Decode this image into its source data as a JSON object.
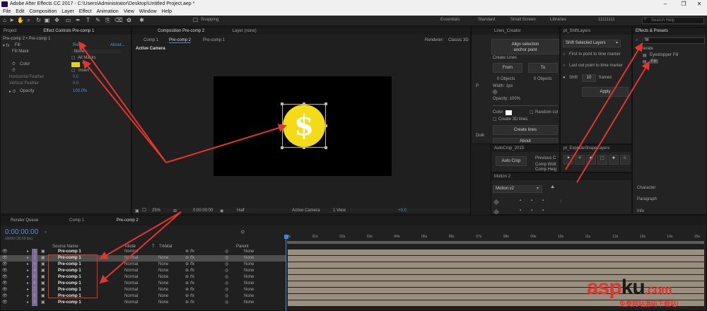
{
  "titlebar": {
    "title": "Adobe After Effects CC 2017 - C:\\Users\\Administrator\\Desktop\\Untitled Project.aep *"
  },
  "menu": [
    "File",
    "Edit",
    "Composition",
    "Layer",
    "Effect",
    "Animation",
    "View",
    "Window",
    "Help"
  ],
  "toolbar": {
    "snapping": "Snapping",
    "workspaces": [
      "Essentials",
      "Standard",
      "Small Screen",
      "Libraries",
      "11111111"
    ],
    "search_placeholder": "Search Help"
  },
  "left_panel": {
    "tab_project": "Project",
    "tab_effect_controls": "Effect Controls Pre-comp 1",
    "breadcrumb": "Pre-comp 2 • Pre-comp 1",
    "effect_name": "Fill",
    "reset": "Reset",
    "about": "About...",
    "fill_mask_label": "Fill Mask",
    "fill_mask_value": "None",
    "all_masks": "All Masks",
    "color_label": "Color",
    "invert": "Invert",
    "horizontal_feather": "Horizontal Feather",
    "horizontal_feather_value": "0.0",
    "vertical_feather": "Vertical Feather",
    "vertical_feather_value": "0.0",
    "opacity_label": "Opacity",
    "opacity_value": "100.0%"
  },
  "comp_panel": {
    "tab_comp": "Composition Pre-comp 2",
    "tab_layer": "Layer (none)",
    "crumb1": "Comp 1",
    "crumb2": "Pre-comp 2",
    "crumb3": "Pre-comp 1",
    "renderer_label": "Renderer:",
    "renderer_value": "Classic 3D",
    "active_camera": "Active Camera",
    "zoom": "25%",
    "timecode": "0:00:00:00",
    "resolution": "Half",
    "view": "Active Camera",
    "views": "1 View",
    "exposure": "+0.0"
  },
  "lines_creator": {
    "title": "Lines_Creator",
    "align": "Align selection",
    "anchor": "anchor point",
    "create_lines": "Create Lines",
    "from": "From",
    "to": "To",
    "objects_from": "0 Objects",
    "objects_to": "0 Objects",
    "width": "Width: 1px",
    "opacity": "Opacity: 100%",
    "color": "Color",
    "random_col": "Random col",
    "create_3d": "Create 3D lines",
    "create_lines_btn": "Create lines",
    "about": "About",
    "duik": "Duik"
  },
  "shift_layers": {
    "title": "pt_ShiftLayers",
    "dropdown": "Shift Selected Layers",
    "first_in": "First in point to time marker",
    "last_out": "Last out point to time marker",
    "shift_label": "Shift",
    "shift_value": "10",
    "frames": "frames",
    "apply": "Apply"
  },
  "autocrop": {
    "title": "AutoCrop_2015",
    "btn": "Auto Crop",
    "previous": "Previous C",
    "comp_width": "Comp Widt",
    "comp_height": "Comp Heig"
  },
  "explode": {
    "title": "pt_ExplodeShapeLayers"
  },
  "motion": {
    "title": "Motion 2",
    "dropdown": "Motion v2"
  },
  "effects_presets": {
    "title": "Effects & Presets",
    "search": "fill",
    "category": "Generate",
    "item1": "Eyedropper Fill",
    "item2": "Fill",
    "character": "Character",
    "paragraph": "Paragraph",
    "info": "Info"
  },
  "timeline": {
    "tab_render": "Render Queue",
    "tab_comp1": "Comp 1",
    "tab_precomp2": "Pre-comp 2",
    "timecode": "0:00:00:00",
    "fps": "00000 (30.00 fps)",
    "col_source": "Source Name",
    "col_mode": "Mode",
    "col_t": "T",
    "col_trkmat": "TrkMat",
    "col_parent": "Parent",
    "layers": [
      {
        "num": "1",
        "name": "Pre-comp 1",
        "mode": "Normal",
        "trkmat": "",
        "parent": "None"
      },
      {
        "num": "2",
        "name": "Pre-comp 1",
        "mode": "Normal",
        "trkmat": "None",
        "parent": "None"
      },
      {
        "num": "3",
        "name": "Pre-comp 1",
        "mode": "Normal",
        "trkmat": "None",
        "parent": "None"
      },
      {
        "num": "4",
        "name": "Pre-comp 1",
        "mode": "Normal",
        "trkmat": "None",
        "parent": "None"
      },
      {
        "num": "5",
        "name": "Pre-comp 1",
        "mode": "Normal",
        "trkmat": "None",
        "parent": "None"
      },
      {
        "num": "6",
        "name": "Pre-comp 1",
        "mode": "Normal",
        "trkmat": "None",
        "parent": "None"
      },
      {
        "num": "7",
        "name": "Pre-comp 1",
        "mode": "Normal",
        "trkmat": "None",
        "parent": "None"
      },
      {
        "num": "8",
        "name": "Pre-comp 1",
        "mode": "Normal",
        "trkmat": "None",
        "parent": "None"
      },
      {
        "num": "9",
        "name": "Pre-comp 1",
        "mode": "Normal",
        "trkmat": "None",
        "parent": "None"
      }
    ],
    "ruler": [
      "00s",
      "01s",
      "02s",
      "03s",
      "04s",
      "05s",
      "06s",
      "07s",
      "08s",
      "09s",
      "10s",
      "11s",
      "12s",
      "13s",
      "14s",
      "15s"
    ]
  },
  "watermark": {
    "a": "asp",
    "b": "ku",
    "c": ".com",
    "sub": "免费网站源码下载站!"
  },
  "colors": {
    "coin": "#f3db17",
    "accent_blue": "#4d93d8",
    "arrow": "#e0372c"
  }
}
